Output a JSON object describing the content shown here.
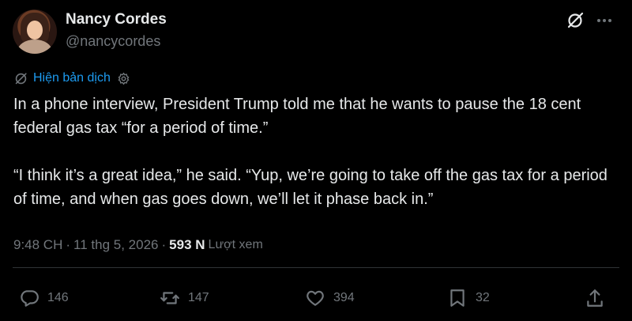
{
  "author": {
    "name": "Nancy Cordes",
    "handle": "@nancycordes"
  },
  "translate_label": "Hiện bản dịch",
  "tweet": {
    "text": "In a phone interview, President Trump told me that he wants to pause the 18 cent federal gas tax “for a period of time.”\n\n“I think it’s a great idea,” he said. “Yup, we’re going to take off the gas tax for a period of time, and when gas goes down, we’ll let it phase back in.”"
  },
  "meta": {
    "time": "9:48 CH",
    "separator": "·",
    "date": "11 thg 5, 2026",
    "views_count": "593 N",
    "views_label": "Lượt xem"
  },
  "actions": {
    "replies": "146",
    "reposts": "147",
    "likes": "394",
    "bookmarks": "32"
  },
  "colors": {
    "background": "#000000",
    "text": "#e7e9ea",
    "secondary": "#71767b",
    "link": "#1d9bf0",
    "divider": "#2f3336"
  },
  "icons": [
    "grok-icon",
    "more-icon",
    "translate-icon",
    "gear-icon",
    "reply-icon",
    "repost-icon",
    "like-icon",
    "bookmark-icon",
    "share-icon"
  ]
}
